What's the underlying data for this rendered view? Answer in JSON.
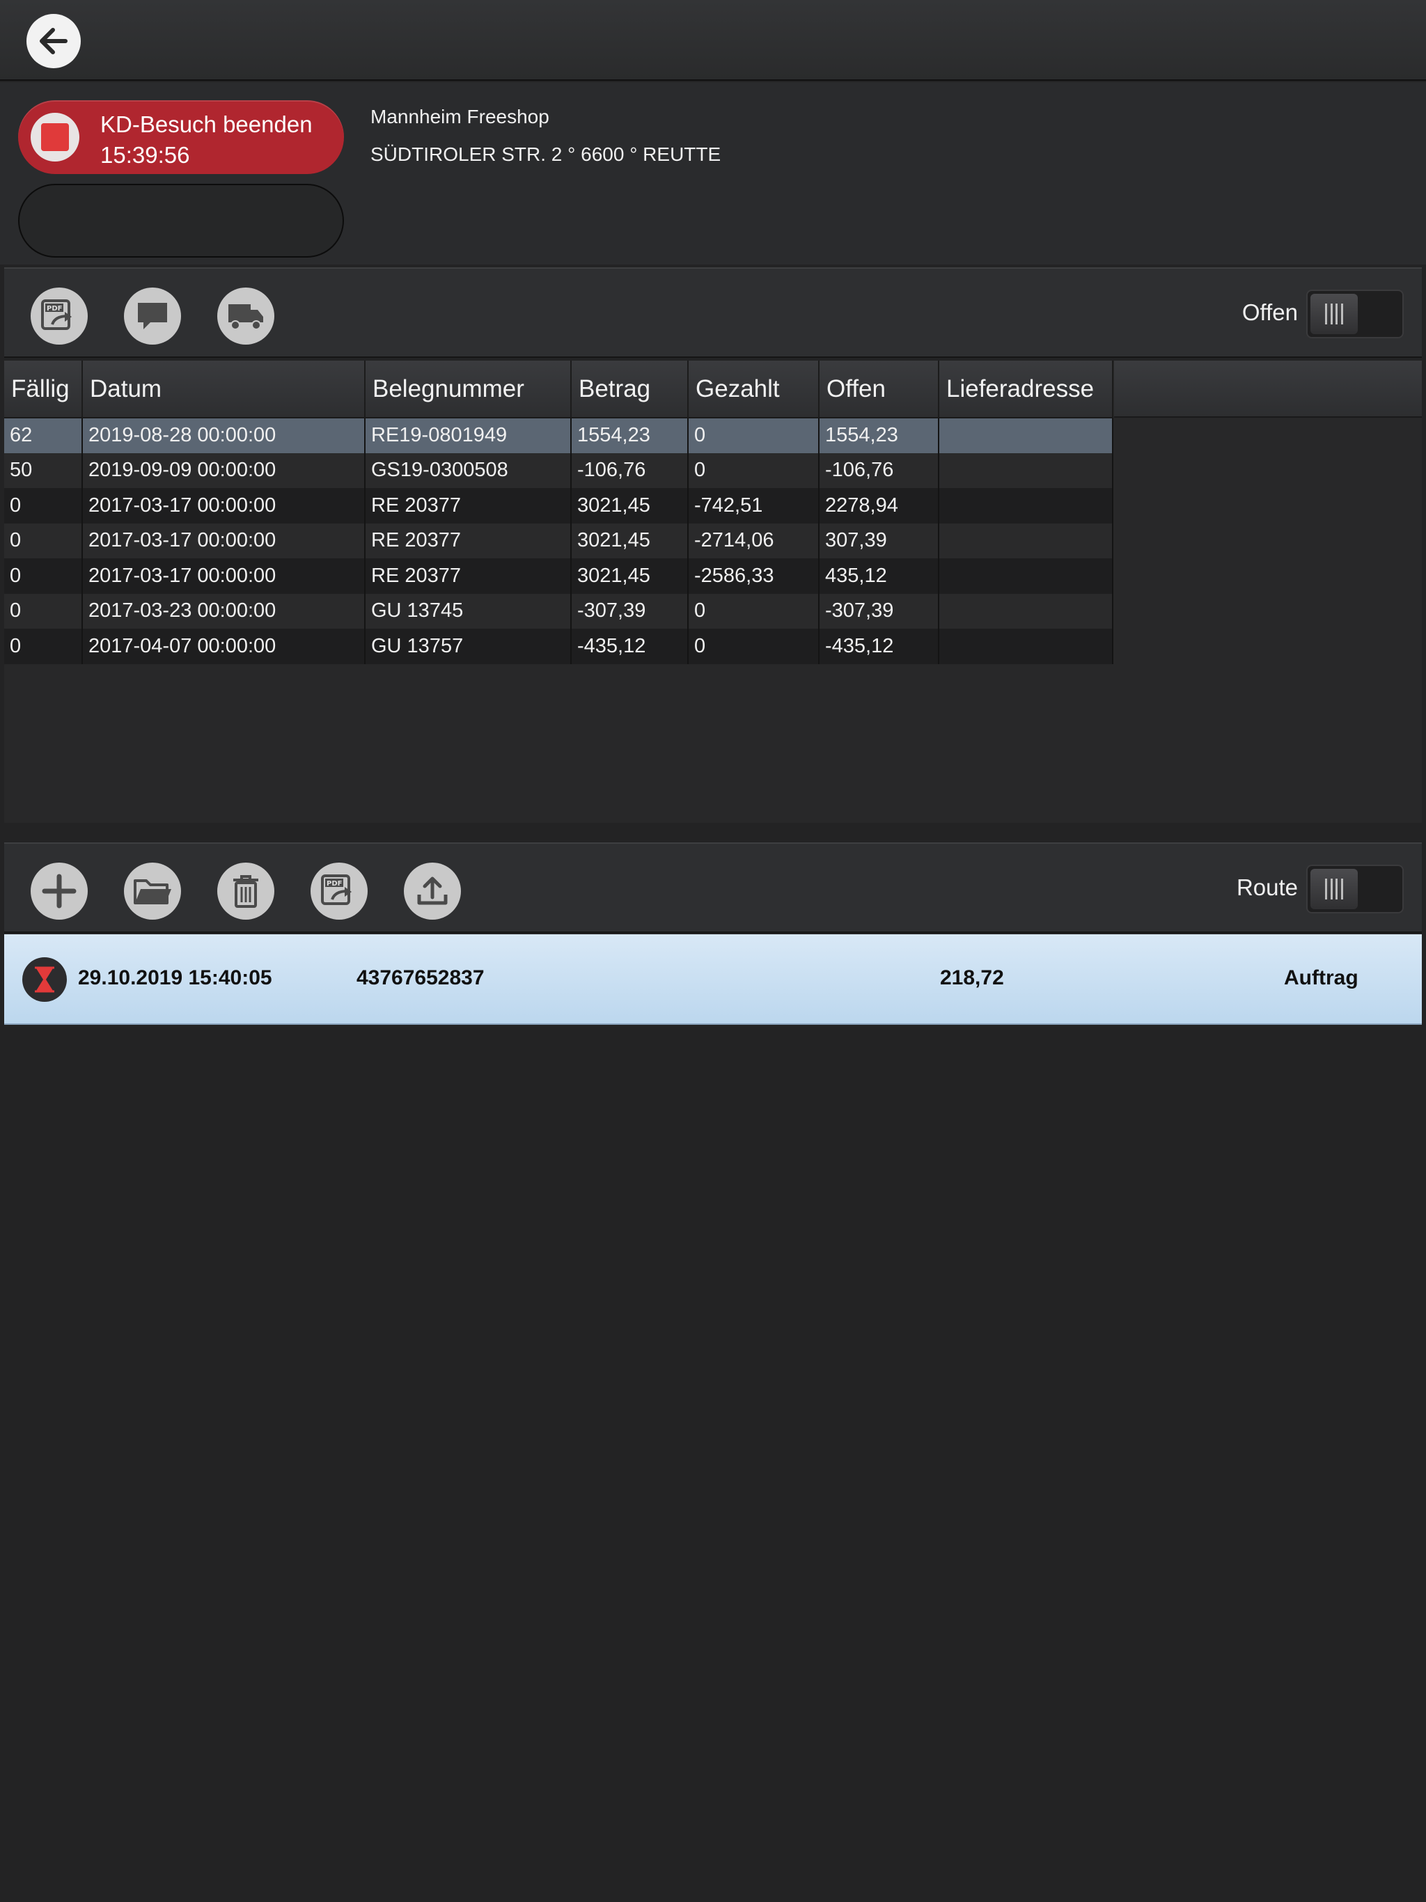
{
  "topbar": {
    "back_icon": "arrow-left-icon"
  },
  "visit": {
    "end_label": "KD-Besuch beenden",
    "time": "15:39:56",
    "customer_name": "Mannheim Freeshop",
    "customer_address": "SÜDTIROLER STR. 2 ° 6600 ° REUTTE"
  },
  "toolbar1": {
    "icons": [
      "pdf-share-icon",
      "chat-icon",
      "truck-icon"
    ],
    "toggle_label": "Offen",
    "toggle_on": false
  },
  "invoices": {
    "columns": [
      "Fällig",
      "Datum",
      "Belegnummer",
      "Betrag",
      "Gezahlt",
      "Offen",
      "Lieferadresse"
    ],
    "rows": [
      [
        "62",
        "2019-08-28 00:00:00",
        "RE19-0801949",
        "1554,23",
        "0",
        "1554,23",
        ""
      ],
      [
        "50",
        "2019-09-09 00:00:00",
        "GS19-0300508",
        "-106,76",
        "0",
        "-106,76",
        ""
      ],
      [
        "0",
        "2017-03-17 00:00:00",
        "RE  20377",
        "3021,45",
        "-742,51",
        "2278,94",
        ""
      ],
      [
        "0",
        "2017-03-17 00:00:00",
        "RE  20377",
        "3021,45",
        "-2714,06",
        "307,39",
        ""
      ],
      [
        "0",
        "2017-03-17 00:00:00",
        "RE  20377",
        "3021,45",
        "-2586,33",
        "435,12",
        ""
      ],
      [
        "0",
        "2017-03-23 00:00:00",
        "GU  13745",
        "-307,39",
        "0",
        "-307,39",
        ""
      ],
      [
        "0",
        "2017-04-07 00:00:00",
        "GU 13757",
        "-435,12",
        "0",
        "-435,12",
        ""
      ]
    ],
    "selected_row": 0
  },
  "toolbar2": {
    "icons": [
      "plus-icon",
      "folder-icon",
      "trash-icon",
      "pdf-share-icon",
      "upload-icon"
    ],
    "toggle_label": "Route",
    "toggle_on": false
  },
  "orders": [
    {
      "status_icon": "hourglass-icon",
      "datetime": "29.10.2019 15:40:05",
      "number": "43767652837",
      "amount": "218,72",
      "type": "Auftrag"
    }
  ]
}
